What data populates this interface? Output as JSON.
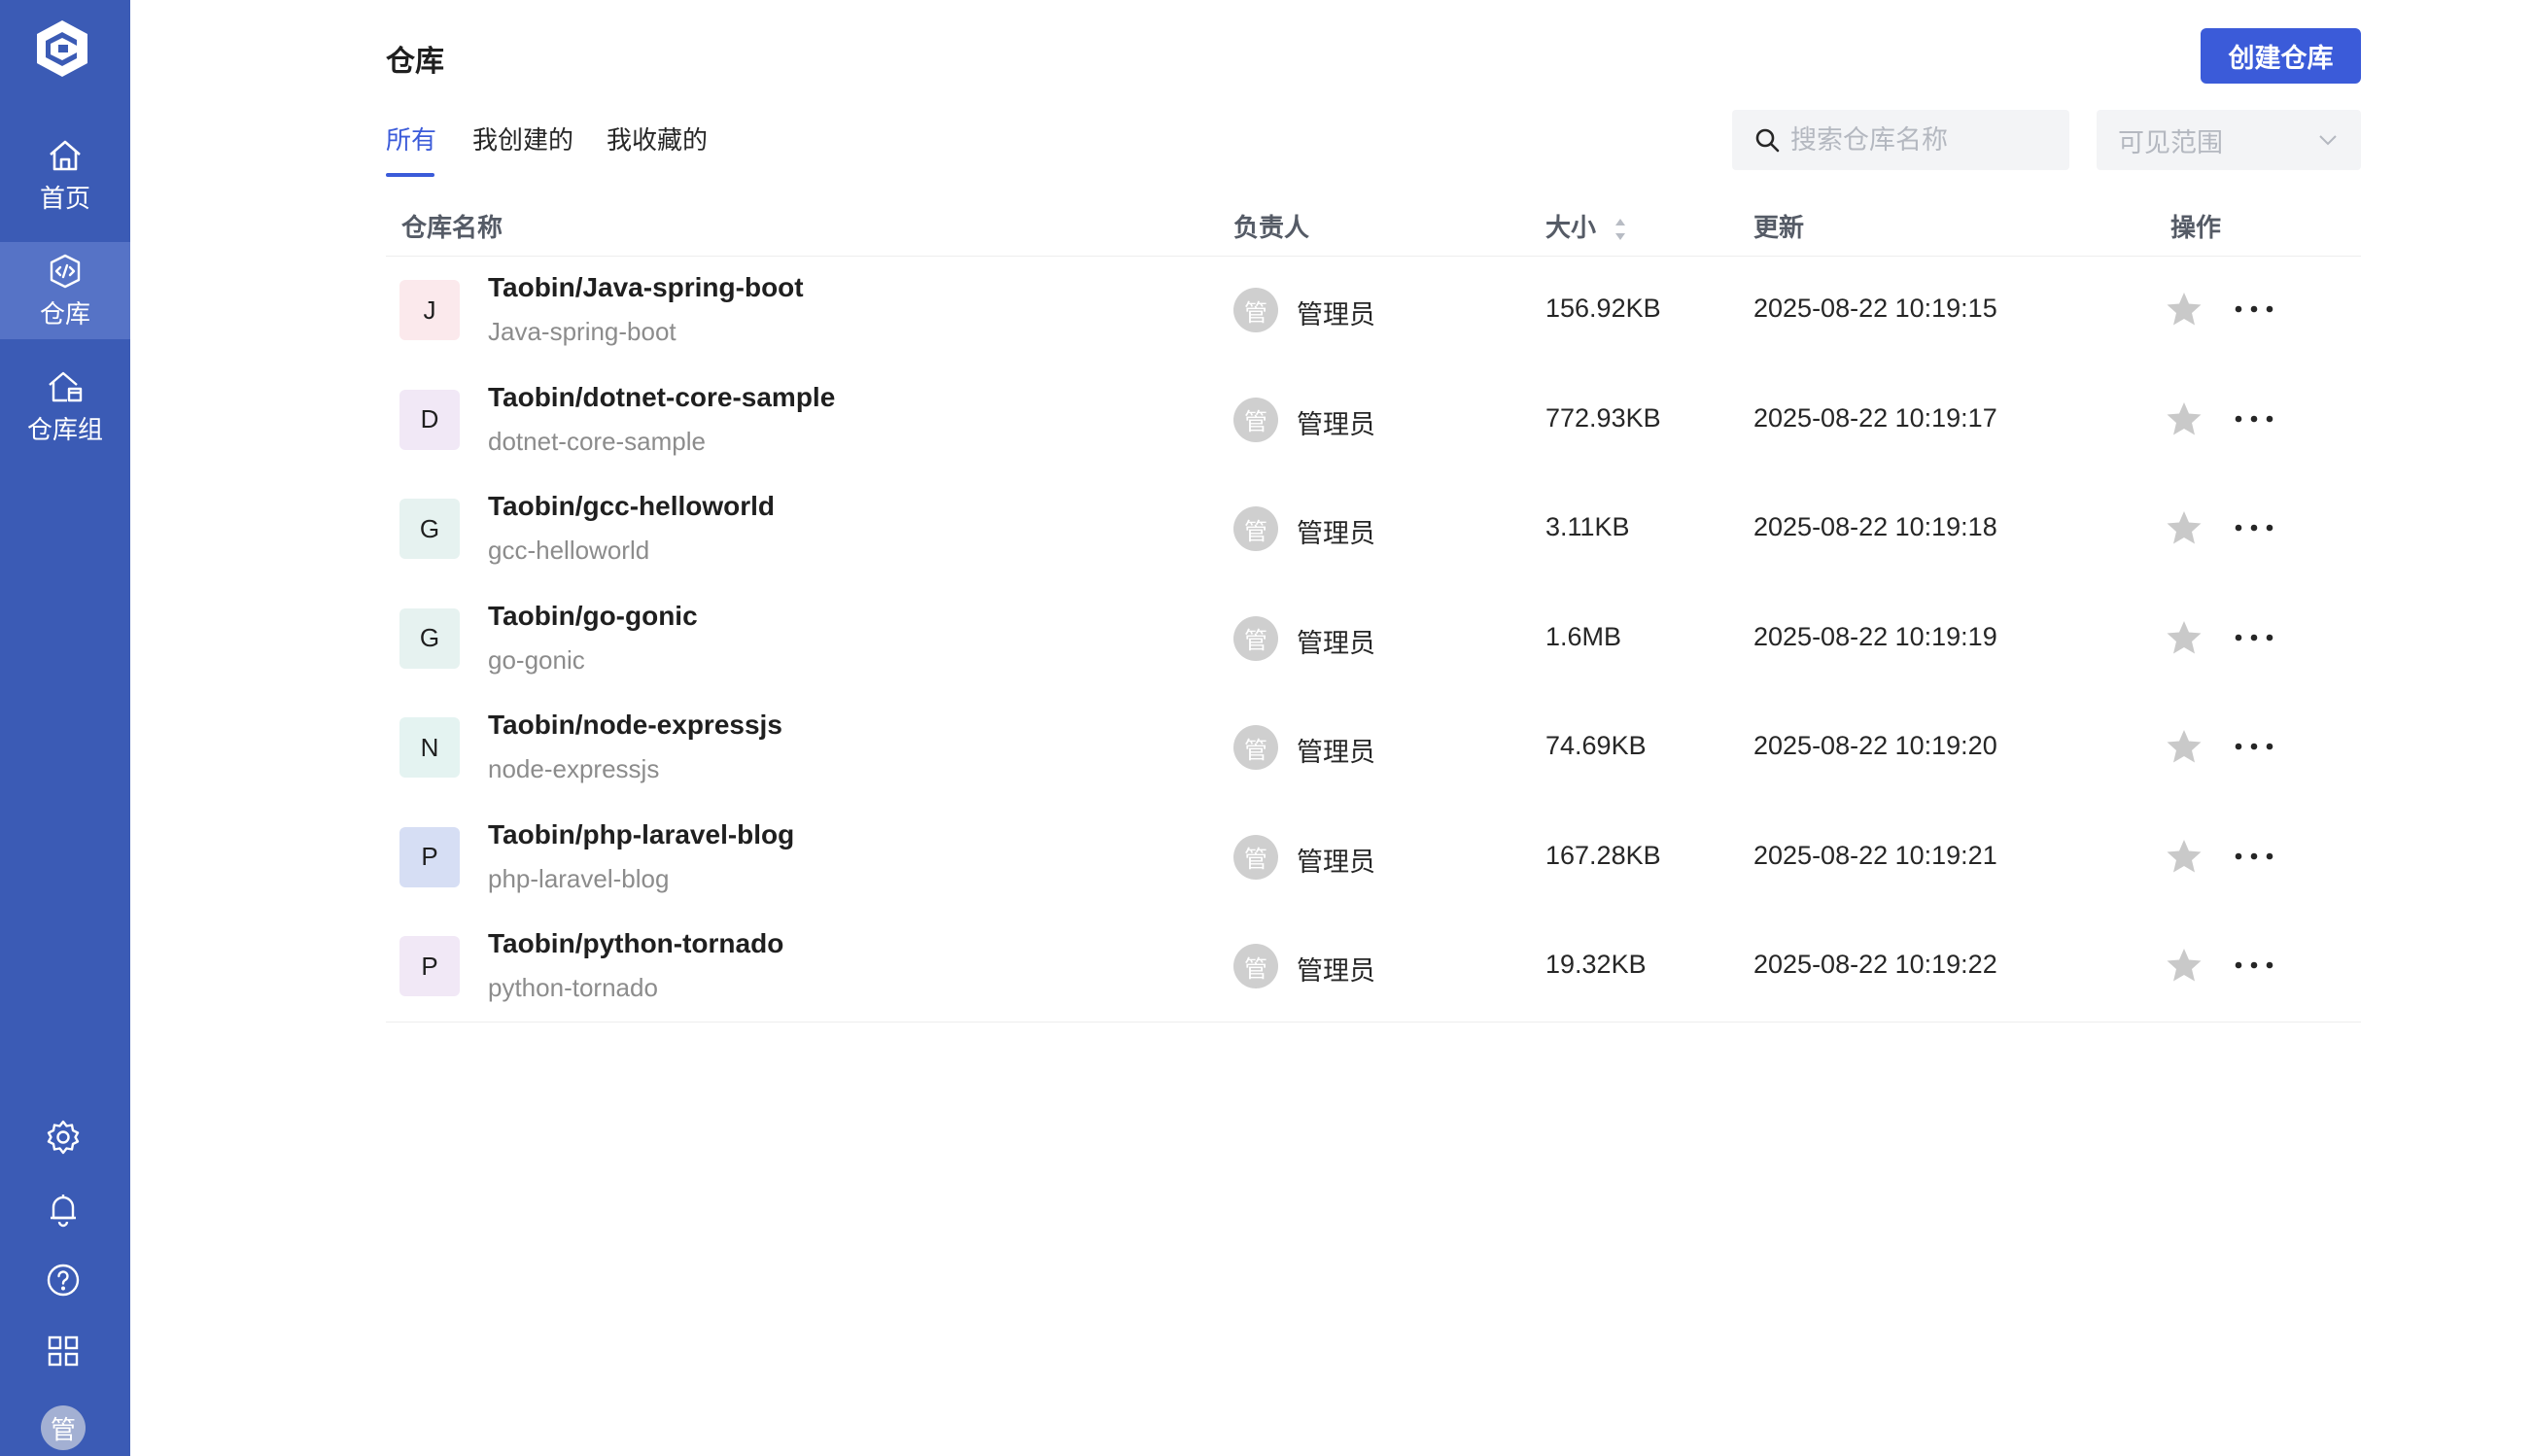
{
  "app": {
    "page_title": "仓库",
    "create_button": "创建仓库"
  },
  "sidebar": {
    "items": [
      {
        "label": "首页",
        "icon": "home-icon"
      },
      {
        "label": "仓库",
        "icon": "repository-icon",
        "active": true
      },
      {
        "label": "仓库组",
        "icon": "repository-group-icon"
      }
    ],
    "bottom_icons": [
      "settings-icon",
      "bell-icon",
      "help-icon",
      "apps-grid-icon"
    ],
    "user_avatar": "管"
  },
  "tabs": [
    {
      "label": "所有",
      "active": true
    },
    {
      "label": "我创建的"
    },
    {
      "label": "我收藏的"
    }
  ],
  "filters": {
    "search_placeholder": "搜索仓库名称",
    "scope_placeholder": "可见范围"
  },
  "table": {
    "columns": {
      "name": "仓库名称",
      "owner": "负责人",
      "size": "大小",
      "updated": "更新",
      "actions": "操作"
    },
    "rows": [
      {
        "initial": "J",
        "avatar_color": "#fbe9ec",
        "full_name": "Taobin/Java-spring-boot",
        "name": "Java-spring-boot",
        "owner_avatar": "管",
        "owner": "管理员",
        "size": "156.92KB",
        "updated": "2025-08-22 10:19:15"
      },
      {
        "initial": "D",
        "avatar_color": "#f1e8f6",
        "full_name": "Taobin/dotnet-core-sample",
        "name": "dotnet-core-sample",
        "owner_avatar": "管",
        "owner": "管理员",
        "size": "772.93KB",
        "updated": "2025-08-22 10:19:17"
      },
      {
        "initial": "G",
        "avatar_color": "#e6f2f0",
        "full_name": "Taobin/gcc-helloworld",
        "name": "gcc-helloworld",
        "owner_avatar": "管",
        "owner": "管理员",
        "size": "3.11KB",
        "updated": "2025-08-22 10:19:18"
      },
      {
        "initial": "G",
        "avatar_color": "#e6f2f0",
        "full_name": "Taobin/go-gonic",
        "name": "go-gonic",
        "owner_avatar": "管",
        "owner": "管理员",
        "size": "1.6MB",
        "updated": "2025-08-22 10:19:19"
      },
      {
        "initial": "N",
        "avatar_color": "#e4f3f1",
        "full_name": "Taobin/node-expressjs",
        "name": "node-expressjs",
        "owner_avatar": "管",
        "owner": "管理员",
        "size": "74.69KB",
        "updated": "2025-08-22 10:19:20"
      },
      {
        "initial": "P",
        "avatar_color": "#d6def4",
        "full_name": "Taobin/php-laravel-blog",
        "name": "php-laravel-blog",
        "owner_avatar": "管",
        "owner": "管理员",
        "size": "167.28KB",
        "updated": "2025-08-22 10:19:21"
      },
      {
        "initial": "P",
        "avatar_color": "#f1e8f6",
        "full_name": "Taobin/python-tornado",
        "name": "python-tornado",
        "owner_avatar": "管",
        "owner": "管理员",
        "size": "19.32KB",
        "updated": "2025-08-22 10:19:22"
      }
    ]
  },
  "colors": {
    "sidebar_bg": "#3b5bb5",
    "sidebar_active": "#5673c6",
    "accent": "#3b5bd9"
  }
}
